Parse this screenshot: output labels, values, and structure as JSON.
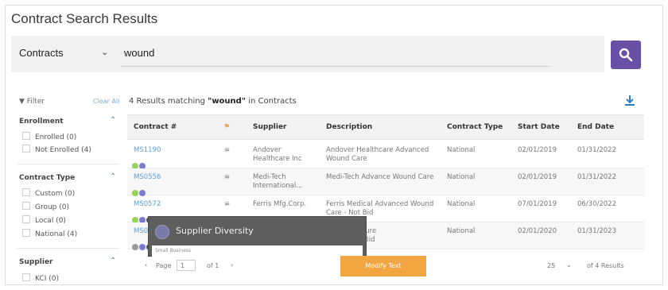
{
  "page_title": "Contract Search Results",
  "search": {
    "scope": "Contracts",
    "query": "wound"
  },
  "filters": {
    "label": "Filter",
    "clear_label": "Clear All",
    "enrollment": {
      "heading": "Enrollment",
      "options": [
        "Enrolled (0)",
        "Not Enrolled (4)"
      ]
    },
    "contract_type": {
      "heading": "Contract Type",
      "options": [
        "Custom (0)",
        "Group (0)",
        "Local (0)",
        "National (4)"
      ]
    },
    "supplier": {
      "heading": "Supplier",
      "options": [
        "KCI (0)"
      ]
    }
  },
  "results": {
    "count_prefix": "4 Results matching ",
    "query_quoted": "\"wound\"",
    "count_suffix": " in Contracts",
    "columns": [
      "Contract #",
      "",
      "Supplier",
      "Description",
      "Contract Type",
      "Start Date",
      "End Date"
    ],
    "rows": [
      {
        "contract": "MS1190",
        "supplier": "Andover\nHealthcare Inc",
        "description": "Andover Healthcare Advanced\nWound Care",
        "type": "National",
        "start": "02/01/2019",
        "end": "01/31/2022",
        "dots": [
          "#9bd15a",
          "#7a7ad0"
        ]
      },
      {
        "contract": "MS0556",
        "supplier": "Medi-Tech\nInternational...",
        "description": "Medi-Tech Advance Wound Care",
        "type": "National",
        "start": "02/01/2019",
        "end": "01/31/2022",
        "dots": [
          "#9bd15a",
          "#7a7ad0"
        ]
      },
      {
        "contract": "MS0572",
        "supplier": "Ferris Mfg.Corp.",
        "description": "Ferris Medical Advanced Wound\nCare - Not Bid",
        "type": "National",
        "start": "07/01/2019",
        "end": "06/30/2022",
        "dots": [
          "#9bd15a",
          "#7a7ad0",
          "#555"
        ]
      },
      {
        "contract": "MS0610",
        "supplier": "",
        "description": "...tive Pressure\n...ary - Not Bid",
        "type": "National",
        "start": "02/01/2020",
        "end": "01/31/2023",
        "dots": [
          "#999",
          "#7a7ad0",
          "#555"
        ]
      }
    ]
  },
  "tooltip": {
    "title": "Supplier Diversity",
    "sub": "Small Business"
  },
  "pager": {
    "page_label": "Page",
    "page_value": "1",
    "of_label": "of 1",
    "button_label": "Modify Text",
    "per_page": "25",
    "summary": "of 4 Results"
  },
  "colors": {
    "accent": "#6a4fa6",
    "link": "#5a9fd4",
    "orange": "#f2a541"
  }
}
